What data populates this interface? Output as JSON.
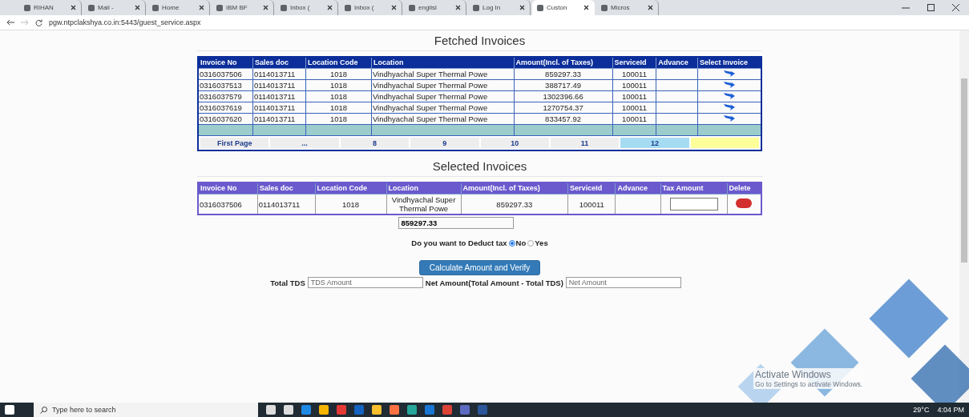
{
  "browser": {
    "tabs": [
      {
        "label": "RIHAN",
        "selected": false
      },
      {
        "label": "Mail - ",
        "selected": false
      },
      {
        "label": "Home",
        "selected": false
      },
      {
        "label": "IBM BF",
        "selected": false
      },
      {
        "label": "Inbox (",
        "selected": false
      },
      {
        "label": "Inbox (",
        "selected": false
      },
      {
        "label": "englisl",
        "selected": false
      },
      {
        "label": "Log In",
        "selected": false
      },
      {
        "label": "Custon",
        "selected": true
      },
      {
        "label": "Micros",
        "selected": false
      }
    ],
    "url": "pgw.ntpclakshya.co.in:5443/guest_service.aspx"
  },
  "fetched": {
    "title": "Fetched Invoices",
    "columns": [
      "Invoice No",
      "Sales doc",
      "Location Code",
      "Location",
      "Amount(Incl. of Taxes)",
      "ServiceId",
      "Advance",
      "Select Invoice"
    ],
    "rows": [
      [
        "0316037506",
        "0114013711",
        "1018",
        "Vindhyachal Super Thermal Powe",
        "859297.33",
        "100011",
        ""
      ],
      [
        "0316037513",
        "0114013711",
        "1018",
        "Vindhyachal Super Thermal Powe",
        "388717.49",
        "100011",
        ""
      ],
      [
        "0316037579",
        "0114013711",
        "1018",
        "Vindhyachal Super Thermal Powe",
        "1302396.66",
        "100011",
        ""
      ],
      [
        "0316037619",
        "0114013711",
        "1018",
        "Vindhyachal Super Thermal Powe",
        "1270754.37",
        "100011",
        ""
      ],
      [
        "0316037620",
        "0114013711",
        "1018",
        "Vindhyachal Super Thermal Powe",
        "833457.92",
        "100011",
        ""
      ]
    ],
    "pager": [
      {
        "label": "First Page",
        "selected": false
      },
      {
        "label": "...",
        "selected": false
      },
      {
        "label": "8",
        "selected": false
      },
      {
        "label": "9",
        "selected": false
      },
      {
        "label": "10",
        "selected": false
      },
      {
        "label": "11",
        "selected": false
      },
      {
        "label": "12",
        "selected": true
      }
    ]
  },
  "selected": {
    "title": "Selected Invoices",
    "columns": [
      "Invoice No",
      "Sales doc",
      "Location Code",
      "Location",
      "Amount(Incl. of Taxes)",
      "ServiceId",
      "Advance",
      "Tax Amount",
      "Delete"
    ],
    "rows": [
      [
        "0316037506",
        "0114013711",
        "1018",
        "Vindhyachal Super Thermal Powe",
        "859297.33",
        "100011",
        ""
      ]
    ],
    "total": "859297.33"
  },
  "deduct": {
    "question": "Do you want to Deduct tax",
    "options": [
      {
        "label": "No",
        "selected": true
      },
      {
        "label": "Yes",
        "selected": false
      }
    ]
  },
  "calculate_button": "Calculate Amount and Verify",
  "totals": {
    "tds_label": "Total TDS",
    "tds_placeholder": "TDS Amount",
    "net_label": "Net Amount(Total Amount - Total TDS)",
    "net_placeholder": "Net Amount"
  },
  "os_notice": {
    "title": "Activate Windows",
    "text": "Go to Settings to activate Windows."
  },
  "taskbar": {
    "search_placeholder": "Type here to search",
    "temperature": "29°C",
    "time": "4:04 PM"
  }
}
